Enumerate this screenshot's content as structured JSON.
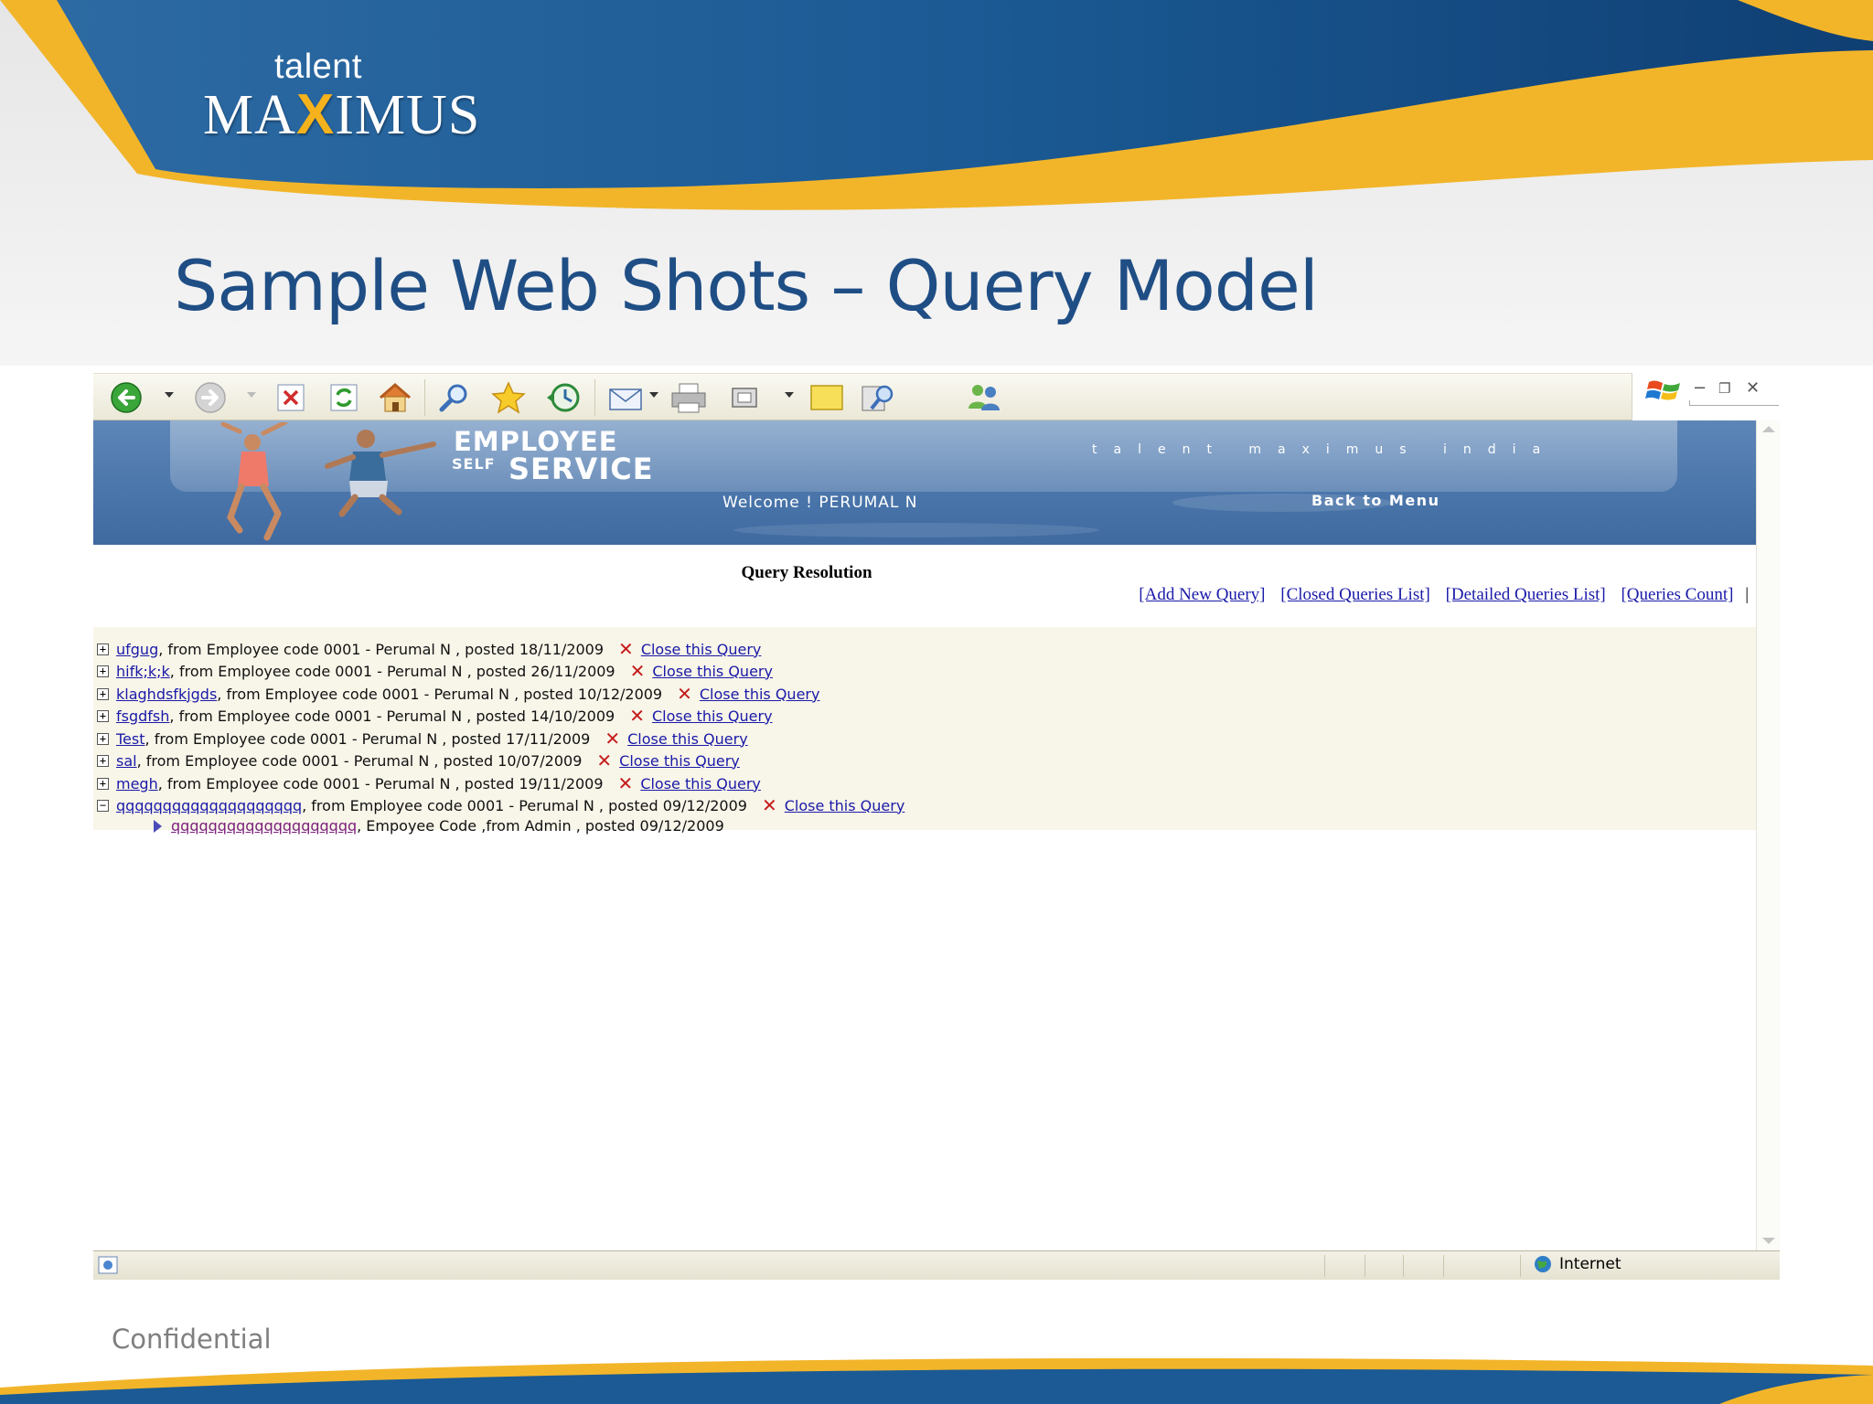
{
  "slide": {
    "logo_small": "talent",
    "logo_big_left": "MA",
    "logo_big_x": "X",
    "logo_big_right": "IMUS",
    "title": "Sample Web Shots – Query Model",
    "footer": "Confidential",
    "colors": {
      "navy": "#1f4e85",
      "gold": "#f5b21d"
    }
  },
  "browser": {
    "toolbar_icons": [
      "back-icon",
      "forward-icon",
      "stop-icon",
      "refresh-icon",
      "home-icon",
      "search-icon",
      "favorites-icon",
      "history-icon",
      "mail-icon",
      "print-icon",
      "fullscreen-icon",
      "notes-icon",
      "research-icon",
      "messenger-icon"
    ],
    "status_zone": "Internet"
  },
  "ess": {
    "title_line1": "EMPLOYEE",
    "title_self": "SELF",
    "title_service": "SERVICE",
    "tagline": "talent maximus india",
    "welcome": "Welcome ! PERUMAL N",
    "back_to_menu": "Back to Menu"
  },
  "query_resolution": {
    "title": "Query Resolution",
    "links": {
      "add_new": "[Add New Query]",
      "closed_list": "[Closed Queries List]",
      "detailed_list": "[Detailed Queries List]",
      "count": "[Queries Count]"
    },
    "queries": [
      {
        "toggle": "+",
        "subject": "ufgug",
        "details": ", from Employee code 0001 - Perumal N , posted 18/11/2009",
        "close": "Close this Query"
      },
      {
        "toggle": "+",
        "subject": "hifk;k;k",
        "details": ", from Employee code 0001 - Perumal N , posted 26/11/2009",
        "close": "Close this Query"
      },
      {
        "toggle": "+",
        "subject": "klaghdsfkjgds",
        "details": ", from Employee code 0001 - Perumal N , posted 10/12/2009",
        "close": "Close this Query"
      },
      {
        "toggle": "+",
        "subject": "fsgdfsh",
        "details": ", from Employee code 0001 - Perumal N , posted 14/10/2009",
        "close": "Close this Query"
      },
      {
        "toggle": "+",
        "subject": "Test",
        "details": ", from Employee code 0001 - Perumal N , posted 17/11/2009",
        "close": "Close this Query"
      },
      {
        "toggle": "+",
        "subject": "sal",
        "details": ", from Employee code 0001 - Perumal N , posted 10/07/2009",
        "close": "Close this Query"
      },
      {
        "toggle": "+",
        "subject": "megh",
        "details": ", from Employee code 0001 - Perumal N , posted 19/11/2009",
        "close": "Close this Query"
      },
      {
        "toggle": "−",
        "subject": "qqqqqqqqqqqqqqqqqqqq",
        "details": ", from Employee code 0001 - Perumal N , posted 09/12/2009",
        "close": "Close this Query"
      }
    ],
    "reply": {
      "subject": "qqqqqqqqqqqqqqqqqqqq",
      "details": ", Empoyee Code ,from Admin , posted 09/12/2009"
    }
  }
}
